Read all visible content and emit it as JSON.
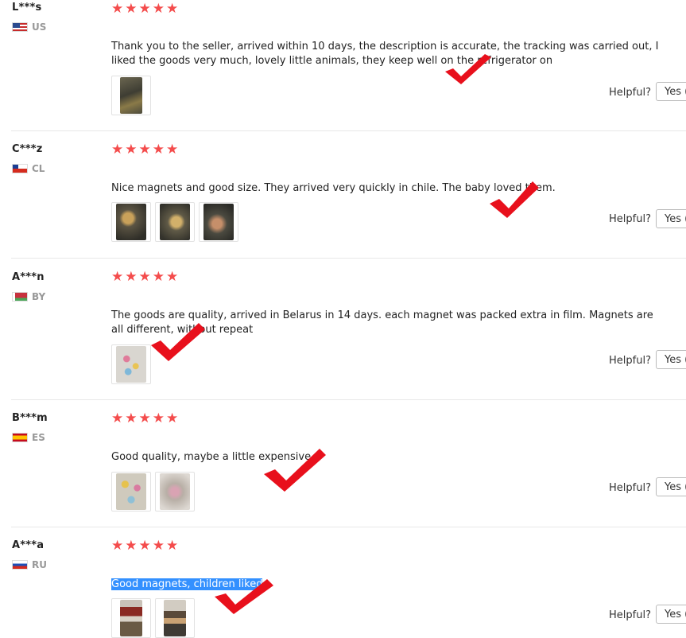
{
  "reviews": [
    {
      "username": "L***s",
      "country": "US",
      "rating": 5,
      "stars": "★★★★★",
      "text": "Thank you to the seller, arrived within 10 days, the description is accurate, the tracking was carried out, I liked the goods very much, lovely little animals, they keep well on the refrigerator on",
      "photo_count": 1,
      "helpful_label": "Helpful?",
      "yes_label": "Yes ("
    },
    {
      "username": "C***z",
      "country": "CL",
      "rating": 5,
      "stars": "★★★★★",
      "text": "Nice magnets and good size. They arrived very quickly in chile. The baby loved them.",
      "photo_count": 3,
      "helpful_label": "Helpful?",
      "yes_label": "Yes ("
    },
    {
      "username": "A***n",
      "country": "BY",
      "rating": 5,
      "stars": "★★★★★",
      "text": "The goods are quality, arrived in Belarus in 14 days. each magnet was packed extra in film. Magnets are all different, without repeat",
      "photo_count": 1,
      "helpful_label": "Helpful?",
      "yes_label": "Yes ("
    },
    {
      "username": "B***m",
      "country": "ES",
      "rating": 5,
      "stars": "★★★★★",
      "text": "Good quality, maybe a little expensive",
      "photo_count": 2,
      "helpful_label": "Helpful?",
      "yes_label": "Yes ("
    },
    {
      "username": "A***a",
      "country": "RU",
      "rating": 5,
      "stars": "★★★★★",
      "text": "Good magnets, children liked",
      "photo_count": 2,
      "helpful_label": "Helpful?",
      "yes_label": "Yes ("
    }
  ],
  "colors": {
    "star": "#f44c4c",
    "checkmark": "#e8101c",
    "selection": "#3390ff"
  }
}
